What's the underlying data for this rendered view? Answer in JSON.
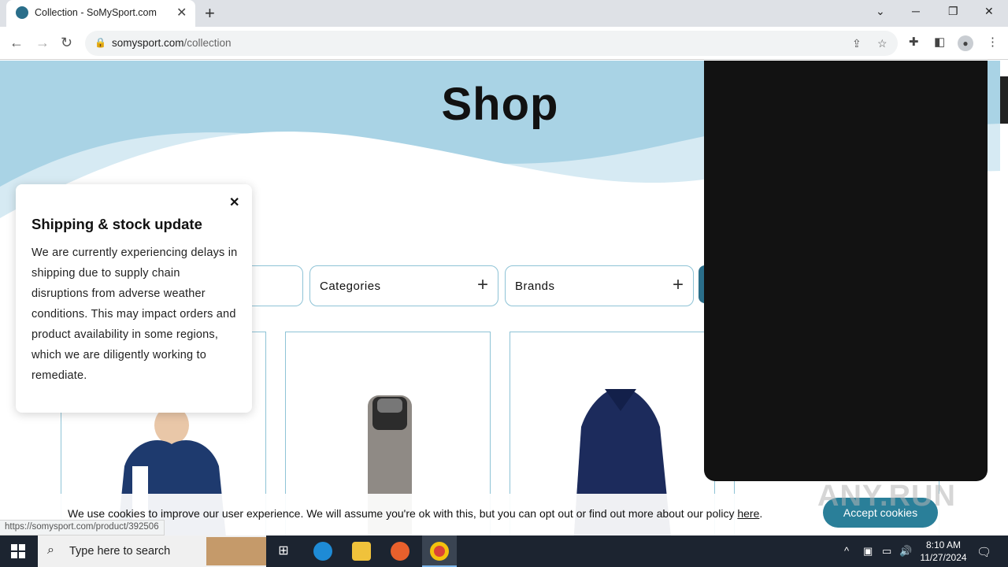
{
  "browser": {
    "tab_title": "Collection - SoMySport.com",
    "url_domain": "somysport.com",
    "url_path": "/collection",
    "status_url": "https://somysport.com/product/392506"
  },
  "page": {
    "title": "Shop",
    "filters": [
      {
        "label": ""
      },
      {
        "label": "Categories"
      },
      {
        "label": "Brands"
      }
    ]
  },
  "popup": {
    "title": "Shipping & stock update",
    "body": "We are currently experiencing delays in shipping due to supply chain disruptions from adverse weather conditions. This may impact orders and product availability in some regions, which we are diligently working to remediate."
  },
  "cookie": {
    "message": "We use cookies to improve our user experience. We will assume you're ok with this, but you can opt out or find out more about our policy ",
    "link": "here",
    "suffix": ".",
    "accept": "Accept cookies"
  },
  "watermark": "ANY.RUN",
  "taskbar": {
    "search_placeholder": "Type here to search",
    "time": "8:10 AM",
    "date": "11/27/2024"
  },
  "colors": {
    "accent": "#2a7f99",
    "hero": "#a9d3e5",
    "border": "#8ec3d6"
  }
}
